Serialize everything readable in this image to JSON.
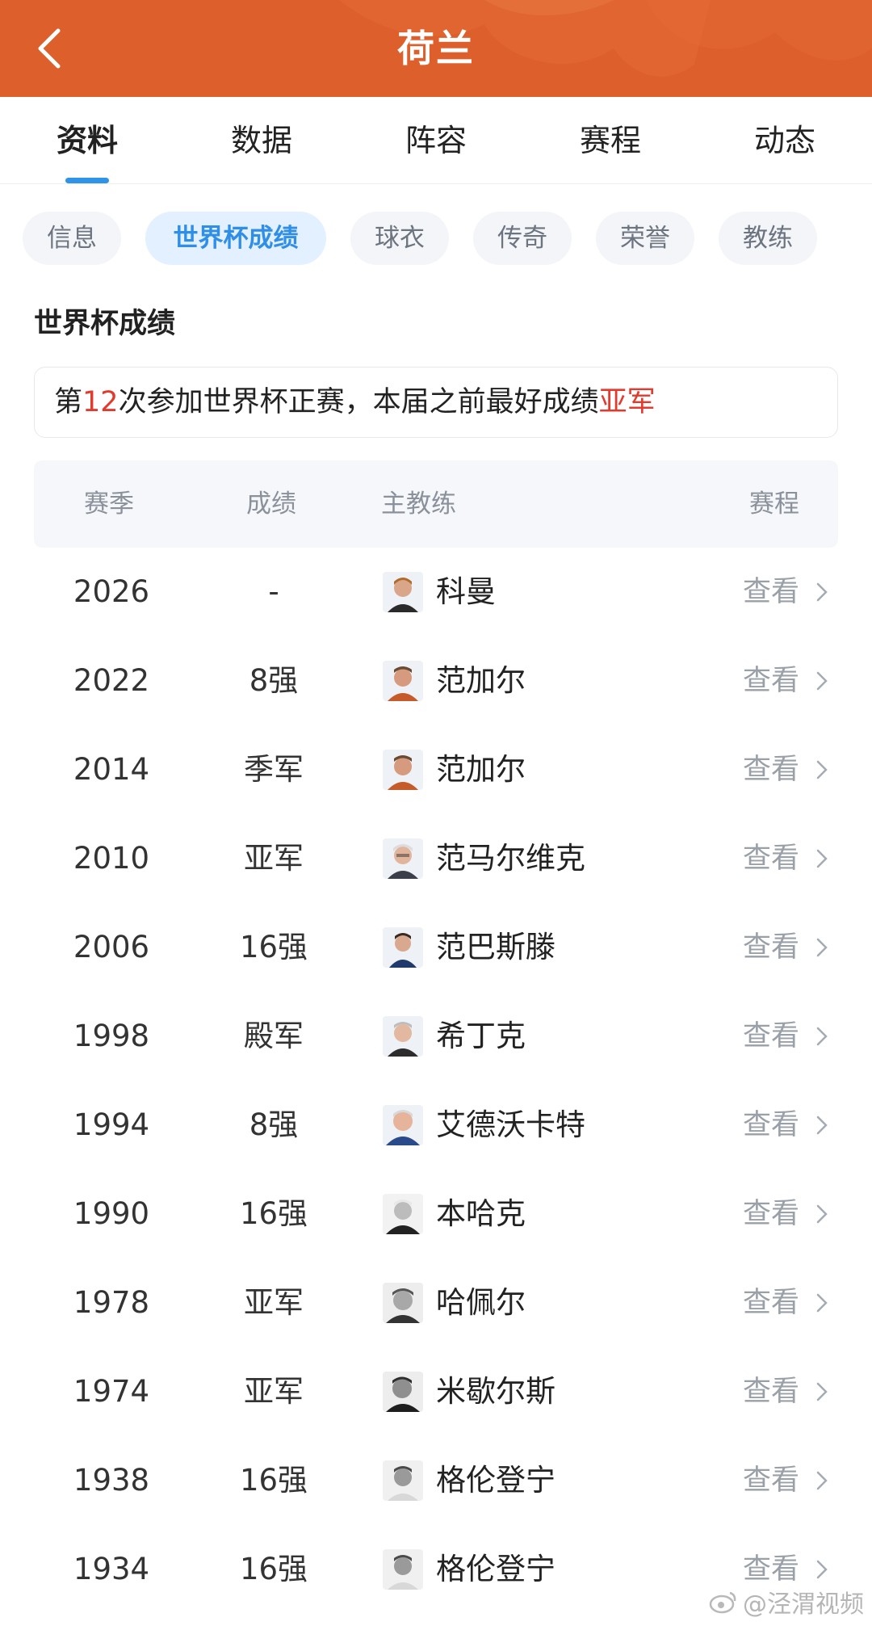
{
  "header": {
    "title": "荷兰",
    "back_icon": "chevron-left-icon",
    "bg_color": "#dd5f2b"
  },
  "main_tabs": [
    {
      "label": "资料",
      "active": true
    },
    {
      "label": "数据",
      "active": false
    },
    {
      "label": "阵容",
      "active": false
    },
    {
      "label": "赛程",
      "active": false
    },
    {
      "label": "动态",
      "active": false
    }
  ],
  "sub_tabs": [
    {
      "label": "信息",
      "active": false
    },
    {
      "label": "世界杯成绩",
      "active": true
    },
    {
      "label": "球衣",
      "active": false
    },
    {
      "label": "传奇",
      "active": false
    },
    {
      "label": "荣誉",
      "active": false
    },
    {
      "label": "教练",
      "active": false
    }
  ],
  "section_title": "世界杯成绩",
  "summary": {
    "prefix": "第",
    "count": "12",
    "middle": "次参加世界杯正赛，本届之前最好成绩",
    "best": "亚军"
  },
  "table": {
    "headers": {
      "season": "赛季",
      "result": "成绩",
      "coach": "主教练",
      "schedule": "赛程"
    },
    "rows": [
      {
        "season": "2026",
        "result": "-",
        "coach": "科曼",
        "view": "查看"
      },
      {
        "season": "2022",
        "result": "8强",
        "coach": "范加尔",
        "view": "查看"
      },
      {
        "season": "2014",
        "result": "季军",
        "coach": "范加尔",
        "view": "查看"
      },
      {
        "season": "2010",
        "result": "亚军",
        "coach": "范马尔维克",
        "view": "查看"
      },
      {
        "season": "2006",
        "result": "16强",
        "coach": "范巴斯滕",
        "view": "查看"
      },
      {
        "season": "1998",
        "result": "殿军",
        "coach": "希丁克",
        "view": "查看"
      },
      {
        "season": "1994",
        "result": "8强",
        "coach": "艾德沃卡特",
        "view": "查看"
      },
      {
        "season": "1990",
        "result": "16强",
        "coach": "本哈克",
        "view": "查看"
      },
      {
        "season": "1978",
        "result": "亚军",
        "coach": "哈佩尔",
        "view": "查看"
      },
      {
        "season": "1974",
        "result": "亚军",
        "coach": "米歇尔斯",
        "view": "查看"
      },
      {
        "season": "1938",
        "result": "16强",
        "coach": "格伦登宁",
        "view": "查看"
      },
      {
        "season": "1934",
        "result": "16强",
        "coach": "格伦登宁",
        "view": "查看"
      }
    ]
  },
  "watermark": "@泾渭视频",
  "colors": {
    "accent_blue": "#2f93e8",
    "highlight_red": "#e23b2e",
    "header_orange": "#dd5f2b"
  }
}
